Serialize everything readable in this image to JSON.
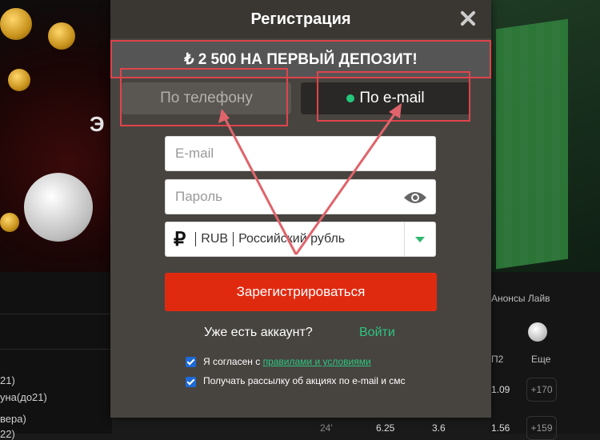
{
  "modal": {
    "title": "Регистрация",
    "promo_text": "₺ 2 500 НА ПЕРВЫЙ ДЕПОЗИТ!",
    "tabs": [
      {
        "label": "По телефону",
        "active": false
      },
      {
        "label": "По e-mail",
        "active": true
      }
    ],
    "email_placeholder": "E-mail",
    "password_placeholder": "Пароль",
    "currency": {
      "code": "RUB",
      "name": "Российский рубль",
      "symbol": "₽"
    },
    "register_button": "Зарегистрироваться",
    "have_account": "Уже есть аккаунт?",
    "login_link": "Войти",
    "agree_prefix": "Я согласен с ",
    "agree_link": "правилами и условиями",
    "newsletter": "Получать рассылку об акциях по e-mail и смс"
  },
  "background": {
    "banner_text": "Э",
    "left_rows": [
      "21)",
      "уна(до21)",
      "вера)",
      "22)"
    ],
    "right_labels": {
      "anons": "Анонсы Лайв",
      "col_header": "П2",
      "more": "Еще"
    },
    "odds": [
      "1.09",
      "+170",
      "24'",
      "6.25",
      "3.6",
      "1.56",
      "+159"
    ]
  },
  "colors": {
    "accent_red": "#e02a10",
    "accent_green": "#2fc47f",
    "annotation": "#e0434b"
  }
}
